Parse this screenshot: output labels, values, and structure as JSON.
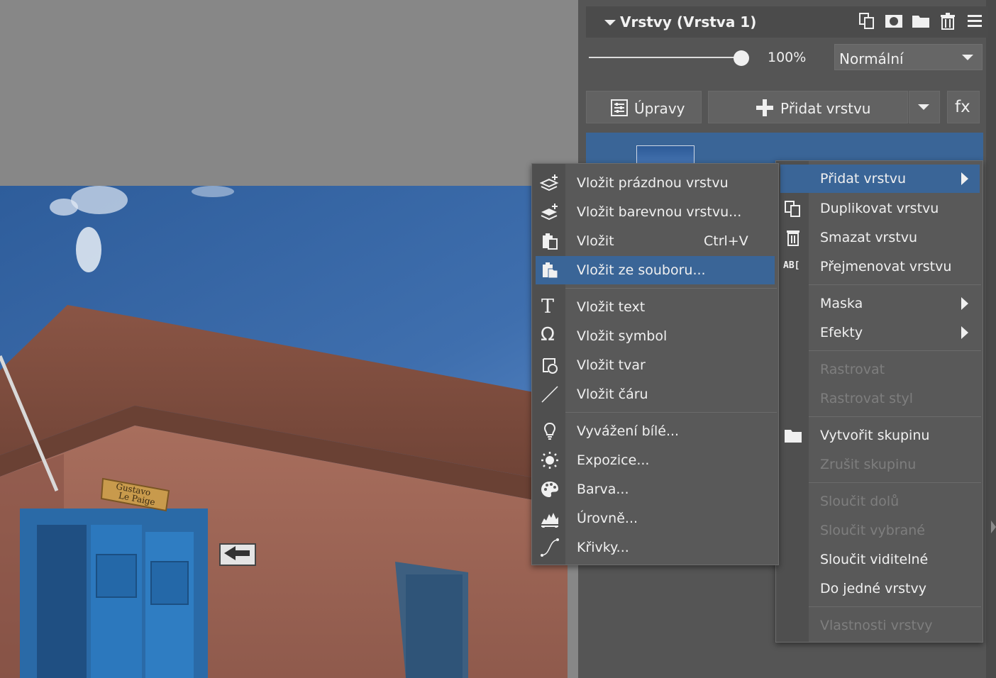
{
  "panel": {
    "title": "Vrstvy (Vrstva 1)",
    "header_icons": [
      "duplicate-icon",
      "mask-icon",
      "folder-icon",
      "trash-icon",
      "menu-icon"
    ],
    "opacity": {
      "value": 1.0,
      "label": "100%"
    },
    "blend_mode": "Normální",
    "buttons": {
      "adjust": "Úpravy",
      "add_layer": "Přidat vrstvu",
      "fx": "fx"
    }
  },
  "layer_context_menu": {
    "items": [
      {
        "label": "Přidat vrstvu",
        "icon": "",
        "submenu": true,
        "highlighted": true,
        "disabled": false
      },
      {
        "label": "Duplikovat vrstvu",
        "icon": "duplicate-icon",
        "submenu": false,
        "highlighted": false,
        "disabled": false
      },
      {
        "label": "Smazat vrstvu",
        "icon": "trash-icon",
        "submenu": false,
        "highlighted": false,
        "disabled": false
      },
      {
        "label": "Přejmenovat vrstvu",
        "icon": "rename-icon",
        "submenu": false,
        "highlighted": false,
        "disabled": false
      },
      {
        "label": "Maska",
        "icon": "",
        "submenu": true,
        "highlighted": false,
        "disabled": false
      },
      {
        "label": "Efekty",
        "icon": "",
        "submenu": true,
        "highlighted": false,
        "disabled": false
      },
      {
        "label": "Rastrovat",
        "icon": "",
        "submenu": false,
        "highlighted": false,
        "disabled": true
      },
      {
        "label": "Rastrovat styl",
        "icon": "",
        "submenu": false,
        "highlighted": false,
        "disabled": true
      },
      {
        "label": "Vytvořit skupinu",
        "icon": "folder-icon",
        "submenu": false,
        "highlighted": false,
        "disabled": false
      },
      {
        "label": "Zrušit skupinu",
        "icon": "",
        "submenu": false,
        "highlighted": false,
        "disabled": true
      },
      {
        "label": "Sloučit dolů",
        "icon": "",
        "submenu": false,
        "highlighted": false,
        "disabled": true
      },
      {
        "label": "Sloučit vybrané",
        "icon": "",
        "submenu": false,
        "highlighted": false,
        "disabled": true
      },
      {
        "label": "Sloučit viditelné",
        "icon": "",
        "submenu": false,
        "highlighted": false,
        "disabled": false
      },
      {
        "label": "Do jedné vrstvy",
        "icon": "",
        "submenu": false,
        "highlighted": false,
        "disabled": false
      },
      {
        "label": "Vlastnosti vrstvy",
        "icon": "",
        "submenu": false,
        "highlighted": false,
        "disabled": true
      }
    ]
  },
  "insert_submenu": {
    "items": [
      {
        "label": "Vložit prázdnou vrstvu",
        "icon": "new-layer-icon",
        "shortcut": "",
        "highlighted": false
      },
      {
        "label": "Vložit barevnou vrstvu...",
        "icon": "color-layer-icon",
        "shortcut": "",
        "highlighted": false
      },
      {
        "label": "Vložit",
        "icon": "paste-icon",
        "shortcut": "Ctrl+V",
        "highlighted": false
      },
      {
        "label": "Vložit ze souboru...",
        "icon": "paste-from-file-icon",
        "shortcut": "",
        "highlighted": true
      },
      {
        "label": "Vložit text",
        "icon": "text-icon",
        "shortcut": "",
        "highlighted": false
      },
      {
        "label": "Vložit symbol",
        "icon": "omega-icon",
        "shortcut": "",
        "highlighted": false
      },
      {
        "label": "Vložit tvar",
        "icon": "shape-icon",
        "shortcut": "",
        "highlighted": false
      },
      {
        "label": "Vložit čáru",
        "icon": "line-icon",
        "shortcut": "",
        "highlighted": false
      },
      {
        "label": "Vyvážení bílé...",
        "icon": "white-balance-icon",
        "shortcut": "",
        "highlighted": false
      },
      {
        "label": "Expozice...",
        "icon": "exposure-icon",
        "shortcut": "",
        "highlighted": false
      },
      {
        "label": "Barva...",
        "icon": "palette-icon",
        "shortcut": "",
        "highlighted": false
      },
      {
        "label": "Úrovně...",
        "icon": "levels-icon",
        "shortcut": "",
        "highlighted": false
      },
      {
        "label": "Křivky...",
        "icon": "curves-icon",
        "shortcut": "",
        "highlighted": false
      }
    ]
  },
  "photo": {
    "sign_text": [
      "Gustavo",
      "Le Paige"
    ]
  },
  "colors": {
    "highlight": "#3a6597",
    "panel": "#555555",
    "menu": "#595959",
    "disabled_text": "#7e7e7e"
  }
}
